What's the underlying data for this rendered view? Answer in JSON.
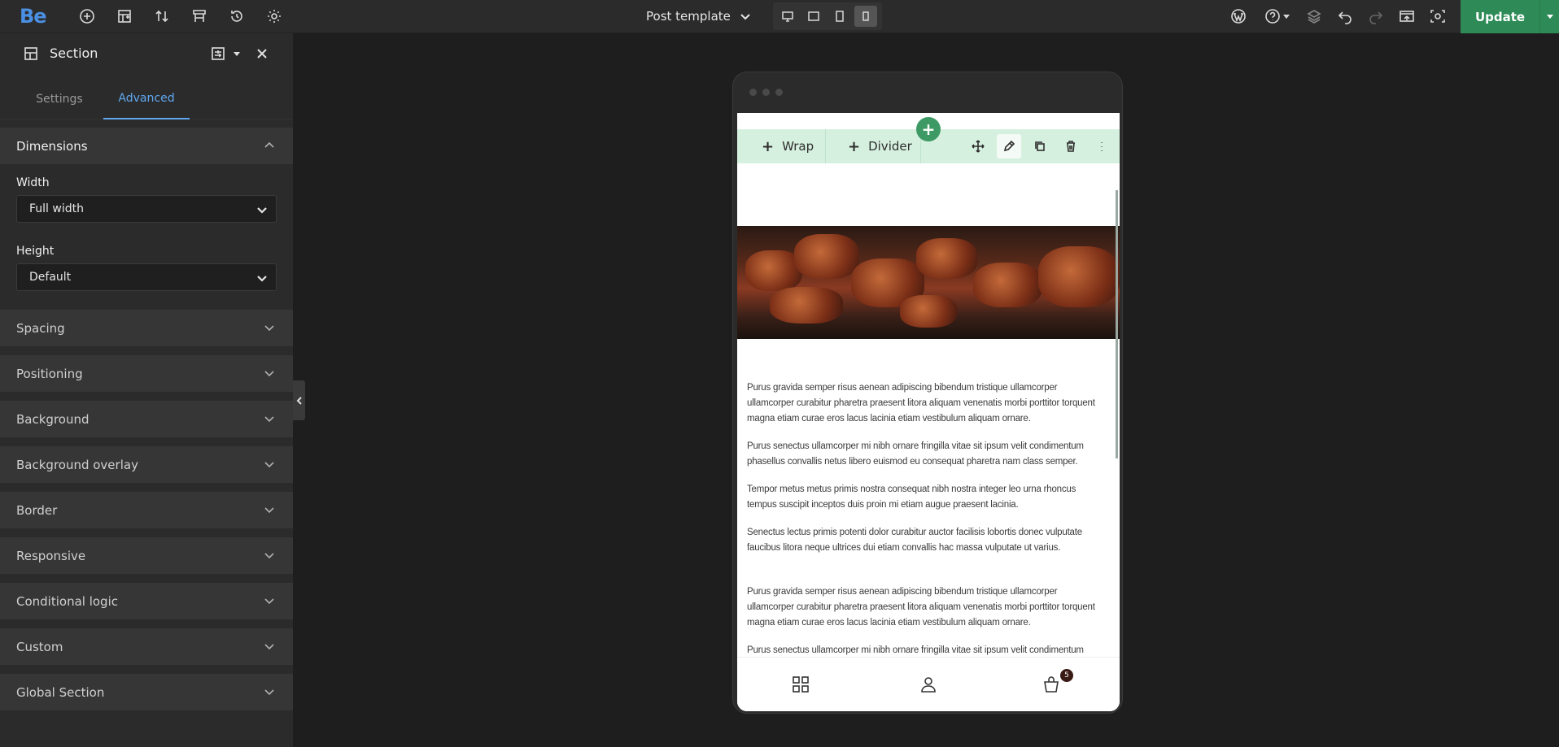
{
  "app": {
    "logo": "Be"
  },
  "topbar": {
    "template_label": "Post template",
    "update_label": "Update"
  },
  "sidebar": {
    "title": "Section",
    "tabs": [
      {
        "label": "Settings",
        "active": false
      },
      {
        "label": "Advanced",
        "active": true
      }
    ],
    "dimensions": {
      "label": "Dimensions",
      "width_label": "Width",
      "width_value": "Full width",
      "height_label": "Height",
      "height_value": "Default"
    },
    "sections": [
      {
        "label": "Spacing"
      },
      {
        "label": "Positioning"
      },
      {
        "label": "Background"
      },
      {
        "label": "Background overlay"
      },
      {
        "label": "Border"
      },
      {
        "label": "Responsive"
      },
      {
        "label": "Conditional logic"
      },
      {
        "label": "Custom"
      },
      {
        "label": "Global Section"
      }
    ]
  },
  "preview": {
    "toolbar": {
      "wrap_label": "Wrap",
      "divider_label": "Divider"
    },
    "paragraphs": [
      "Purus gravida semper risus aenean adipiscing bibendum tristique ullamcorper ullamcorper curabitur pharetra praesent litora aliquam venenatis morbi porttitor torquent magna etiam curae eros lacus lacinia etiam vestibulum aliquam ornare.",
      "Purus senectus ullamcorper mi nibh ornare fringilla vitae sit ipsum velit condimentum phasellus convallis netus libero euismod eu consequat pharetra nam class semper.",
      "Tempor metus metus primis nostra consequat nibh nostra integer leo urna rhoncus tempus suscipit inceptos duis proin mi etiam augue praesent lacinia.",
      "Senectus lectus primis potenti dolor curabitur auctor facilisis lobortis donec vulputate faucibus litora neque ultrices dui etiam convallis hac massa vulputate ut varius.",
      "Purus gravida semper risus aenean adipiscing bibendum tristique ullamcorper ullamcorper curabitur pharetra praesent litora aliquam venenatis morbi porttitor torquent magna etiam curae eros lacus lacinia etiam vestibulum aliquam ornare.",
      "Purus senectus ullamcorper mi nibh ornare fringilla vitae sit ipsum velit condimentum"
    ],
    "cart_count": "5"
  }
}
